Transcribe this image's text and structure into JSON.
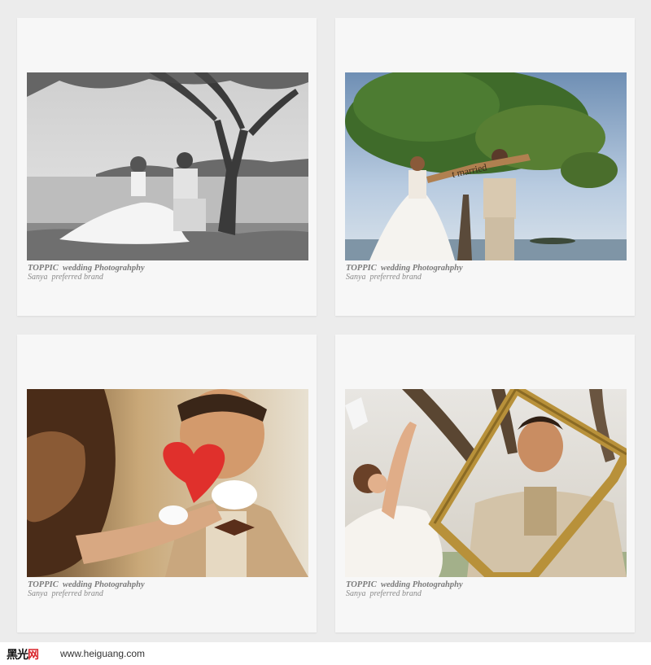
{
  "cards": [
    {
      "caption_brand": "TOPPIC  wedding Photograhphy",
      "caption_tagline": "Sanya  preferred brand",
      "photo": "bw-couple-under-tree-by-sea"
    },
    {
      "caption_brand": "TOPPIC  wedding Photograhphy",
      "caption_tagline": "Sanya  preferred brand",
      "photo": "couple-with-just-married-banner",
      "banner_text": "t married"
    },
    {
      "caption_brand": "TOPPIC  wedding Photograhphy",
      "caption_tagline": "Sanya  preferred brand",
      "photo": "groom-with-red-heart-card"
    },
    {
      "caption_brand": "TOPPIC  wedding Photograhphy",
      "caption_tagline": "Sanya  preferred brand",
      "photo": "couple-with-gold-picture-frame"
    }
  ],
  "footer": {
    "logo_text": "黑光",
    "logo_accent": "网",
    "site_url": "www.heiguang.com"
  },
  "colors": {
    "page_bg": "#ececec",
    "card_bg": "#f7f7f7",
    "caption_text": "#7a7a7a",
    "logo_accent": "#d9262c"
  }
}
